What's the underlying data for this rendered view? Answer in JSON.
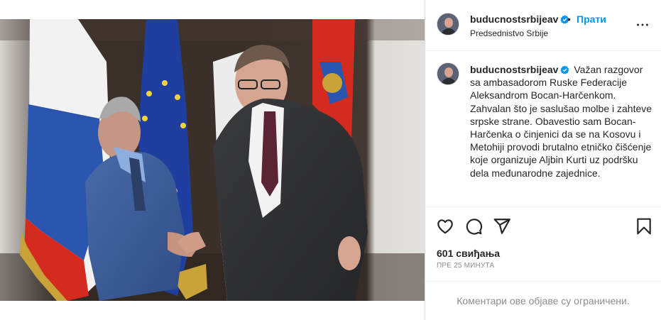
{
  "post": {
    "username": "buducnostsrbijeav",
    "follow_label": "Прати",
    "separator": "•",
    "location": "Predsednistvo Srbije",
    "caption_text": "Važan razgovor sa ambasadorom Ruske Federacije Aleksandrom Bocan-Harčenkom. Zahvalan što je saslušao molbe i zahteve srpske strane. Obavestio sam Bocan-Harčenka o činjenici da se na Kosovu i Metohiji provodi brutalno etničko čišćenje koje organizuje Aljbin Kurti uz podršku dela međunarodne zajednice.",
    "likes": "601 свиђања",
    "time_ago": "пре 25 минута",
    "comments_limited": "Коментари ове објаве су ограничени."
  },
  "icons": {
    "verified": "verified-badge-icon",
    "more": "more-options-icon",
    "like": "heart-icon",
    "comment": "comment-icon",
    "share": "share-icon",
    "save": "bookmark-icon"
  },
  "colors": {
    "accent": "#0095f6",
    "verified": "#0095f6",
    "text": "#262626",
    "muted": "#8e8e8e",
    "border": "#dbdbdb"
  }
}
